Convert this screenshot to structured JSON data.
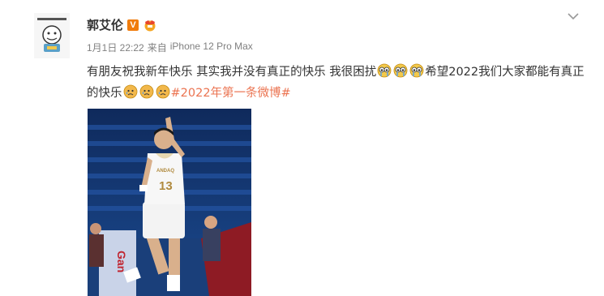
{
  "post": {
    "author": "郭艾伦",
    "vip_badge": "V",
    "date": "1月1日 22:22",
    "source_prefix": "来自",
    "source": "iPhone 12 Pro Max",
    "text_part1": "有朋友祝我新年快乐 其实我并没有真正的快乐 我很困扰",
    "text_part2": "希望2022我们大家都能有真正的快乐",
    "hashtag": "#2022年第一条微博#",
    "emoji_names": [
      "crying-eye-icon",
      "sad-face-icon"
    ],
    "photo": {
      "jersey_team": "ANDAQ",
      "jersey_number": "13",
      "banner_text": "Gan"
    }
  },
  "colors": {
    "link": "#eb7350",
    "badge": "#f07c0d",
    "meta": "#808080",
    "court_blue": "#1b3f7e"
  }
}
